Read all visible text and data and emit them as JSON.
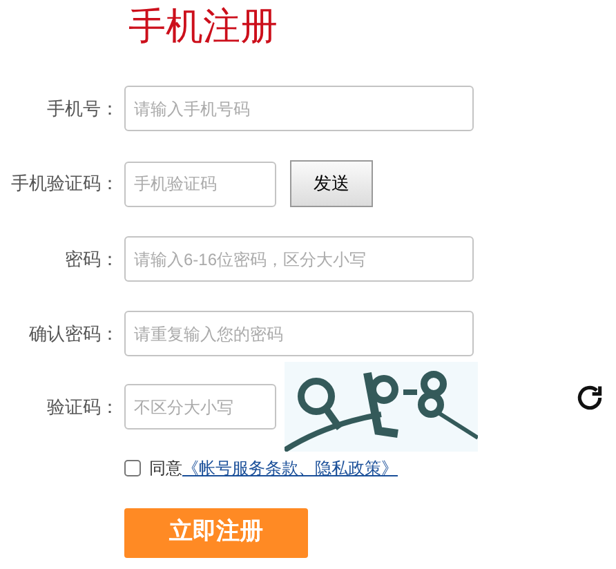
{
  "title": "手机注册",
  "fields": [
    {
      "kind": "text",
      "label": "手机号：",
      "placeholder": "请输入手机号码"
    },
    {
      "kind": "sms",
      "label": "手机验证码：",
      "placeholder": "手机验证码",
      "button": "发送"
    },
    {
      "kind": "text",
      "label": "密码：",
      "placeholder": "请输入6-16位密码，区分大小写"
    },
    {
      "kind": "text",
      "label": "确认密码：",
      "placeholder": "请重复输入您的密码"
    },
    {
      "kind": "captcha",
      "label": "验证码：",
      "placeholder": "不区分大小写"
    }
  ],
  "agreement": {
    "checked": false,
    "text": "同意",
    "link": "《帐号服务条款、隐私政策》"
  },
  "submit": "立即注册"
}
